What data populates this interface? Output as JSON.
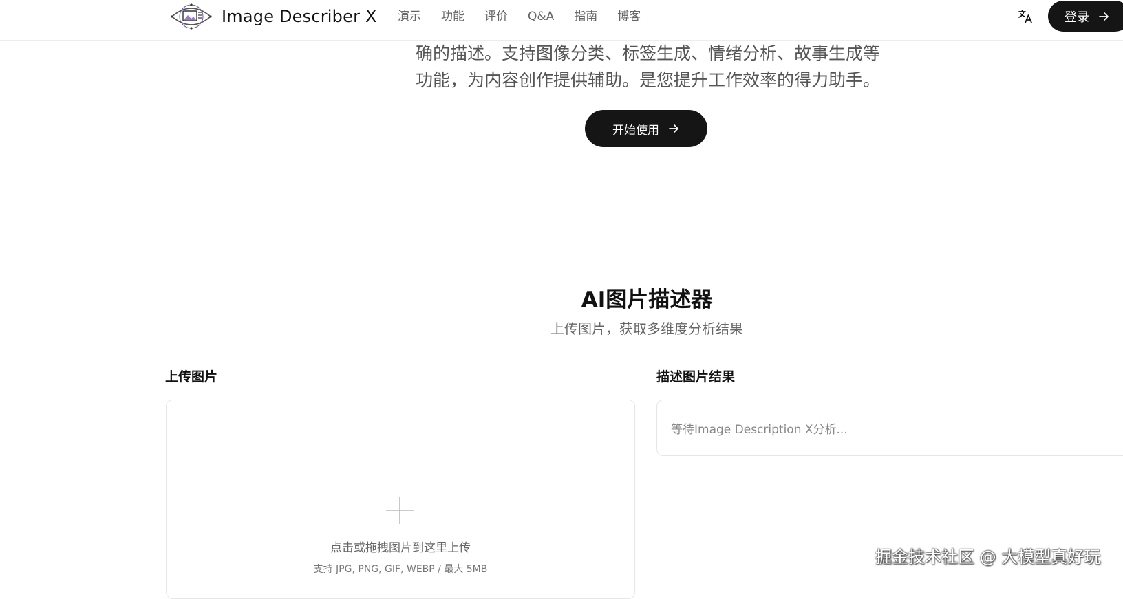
{
  "header": {
    "brand": "Image Describer X",
    "nav": [
      "演示",
      "功能",
      "评价",
      "Q&A",
      "指南",
      "博客"
    ],
    "login_label": "登录"
  },
  "hero": {
    "line1": "确的描述。支持图像分类、标签生成、情绪分析、故事生成等",
    "line2": "功能，为内容创作提供辅助。是您提升工作效率的得力助手。",
    "start_label": "开始使用"
  },
  "describer": {
    "title": "AI图片描述器",
    "subtitle": "上传图片，获取多维度分析结果",
    "upload_label": "上传图片",
    "upload_hint": "点击或拖拽图片到这里上传",
    "upload_formats": "支持 JPG, PNG, GIF, WEBP / 最大 5MB",
    "result_label": "描述图片结果",
    "result_placeholder": "等待Image Description X分析..."
  },
  "watermark": "掘金技术社区 @ 大模型真好玩",
  "icons": {
    "logo": "eye-image-logo-icon",
    "translate": "translate-icon",
    "arrow": "arrow-right-icon",
    "plus": "plus-icon"
  },
  "colors": {
    "primary_button": "#151515",
    "logo_accent": "#6b4fa0"
  }
}
